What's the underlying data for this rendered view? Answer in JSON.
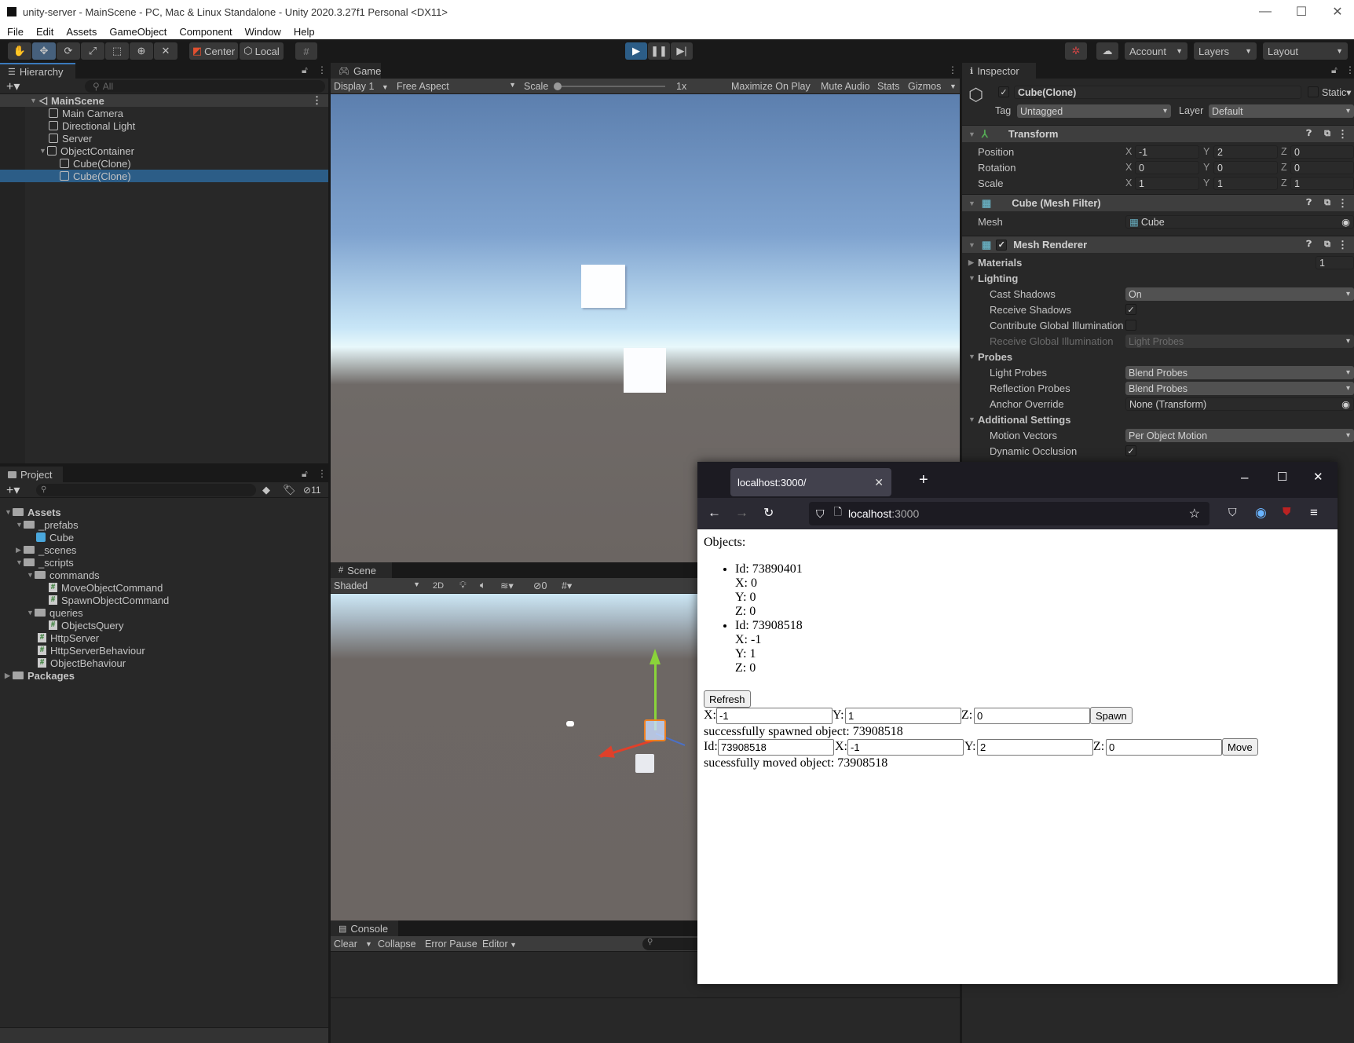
{
  "window": {
    "title": "unity-server - MainScene - PC, Mac & Linux Standalone - Unity 2020.3.27f1 Personal <DX11>",
    "controls": {
      "minimize": "—",
      "maximize": "☐",
      "close": "✕"
    }
  },
  "menu": [
    "File",
    "Edit",
    "Assets",
    "GameObject",
    "Component",
    "Window",
    "Help"
  ],
  "toolbar": {
    "tools": [
      "hand-tool",
      "move-tool",
      "rotate-tool",
      "scale-tool",
      "rect-tool",
      "transform-tool",
      "custom-tool"
    ],
    "pivot_label": "Center",
    "space_label": "Local",
    "account_label": "Account",
    "layers_label": "Layers",
    "layout_label": "Layout"
  },
  "hierarchy": {
    "tab": "Hierarchy",
    "search_placeholder": "All",
    "scene": "MainScene",
    "items": [
      {
        "label": "Main Camera",
        "depth": 1
      },
      {
        "label": "Directional Light",
        "depth": 1
      },
      {
        "label": "Server",
        "depth": 1
      },
      {
        "label": "ObjectContainer",
        "depth": 1,
        "expanded": true
      },
      {
        "label": "Cube(Clone)",
        "depth": 2
      },
      {
        "label": "Cube(Clone)",
        "depth": 2,
        "selected": true
      }
    ]
  },
  "project": {
    "tab": "Project",
    "hidden_count": "11",
    "items": [
      {
        "label": "Assets",
        "type": "folder",
        "bold": true
      },
      {
        "label": "_prefabs",
        "type": "folder"
      },
      {
        "label": "Cube",
        "type": "prefab"
      },
      {
        "label": "_scenes",
        "type": "folder"
      },
      {
        "label": "_scripts",
        "type": "folder"
      },
      {
        "label": "commands",
        "type": "folder"
      },
      {
        "label": "MoveObjectCommand",
        "type": "script"
      },
      {
        "label": "SpawnObjectCommand",
        "type": "script"
      },
      {
        "label": "queries",
        "type": "folder"
      },
      {
        "label": "ObjectsQuery",
        "type": "script"
      },
      {
        "label": "HttpServer",
        "type": "script"
      },
      {
        "label": "HttpServerBehaviour",
        "type": "script"
      },
      {
        "label": "ObjectBehaviour",
        "type": "script"
      },
      {
        "label": "Packages",
        "type": "folder",
        "bold": true
      }
    ]
  },
  "game": {
    "tab": "Game",
    "display": "Display 1",
    "aspect": "Free Aspect",
    "scale_label": "Scale",
    "scale_value": "1x",
    "maximize": "Maximize On Play",
    "mute": "Mute Audio",
    "stats": "Stats",
    "gizmos": "Gizmos"
  },
  "scene": {
    "tab": "Scene",
    "shading": "Shaded",
    "mode_2d": "2D",
    "hidden_count": "0"
  },
  "console": {
    "tab": "Console",
    "clear": "Clear",
    "collapse": "Collapse",
    "error_pause": "Error Pause",
    "editor": "Editor"
  },
  "inspector": {
    "tab": "Inspector",
    "object_name": "Cube(Clone)",
    "static_label": "Static",
    "tag_label": "Tag",
    "tag_value": "Untagged",
    "layer_label": "Layer",
    "layer_value": "Default",
    "transform": {
      "title": "Transform",
      "rows": [
        {
          "label": "Position",
          "x": "-1",
          "y": "2",
          "z": "0"
        },
        {
          "label": "Rotation",
          "x": "0",
          "y": "0",
          "z": "0"
        },
        {
          "label": "Scale",
          "x": "1",
          "y": "1",
          "z": "1"
        }
      ]
    },
    "mesh_filter": {
      "title": "Cube (Mesh Filter)",
      "mesh_label": "Mesh",
      "mesh_value": "Cube"
    },
    "mesh_renderer": {
      "title": "Mesh Renderer",
      "materials_label": "Materials",
      "materials_count": "1",
      "lighting": "Lighting",
      "cast_shadows_label": "Cast Shadows",
      "cast_shadows_value": "On",
      "receive_shadows_label": "Receive Shadows",
      "contribute_gi_label": "Contribute Global Illumination",
      "receive_gi_label": "Receive Global Illumination",
      "receive_gi_value": "Light Probes",
      "probes": "Probes",
      "light_probes_label": "Light Probes",
      "light_probes_value": "Blend Probes",
      "reflection_probes_label": "Reflection Probes",
      "reflection_probes_value": "Blend Probes",
      "anchor_label": "Anchor Override",
      "anchor_value": "None (Transform)",
      "additional": "Additional Settings",
      "motion_vectors_label": "Motion Vectors",
      "motion_vectors_value": "Per Object Motion",
      "dynamic_occlusion_label": "Dynamic Occlusion"
    }
  },
  "browser": {
    "tab_title": "localhost:3000/",
    "url_host": "localhost",
    "url_port": ":3000",
    "page": {
      "heading": "Objects:",
      "objects": [
        {
          "id": "Id: 73890401",
          "x": "X: 0",
          "y": "Y: 0",
          "z": "Z: 0"
        },
        {
          "id": "Id: 73908518",
          "x": "X: -1",
          "y": "Y: 1",
          "z": "Z: 0"
        }
      ],
      "refresh": "Refresh",
      "spawn_form": {
        "x_label": "X:",
        "x": "-1",
        "y_label": "Y:",
        "y": "1",
        "z_label": "Z:",
        "z": "0",
        "button": "Spawn"
      },
      "spawn_status": "successfully spawned object: 73908518",
      "move_form": {
        "id_label": "Id:",
        "id": "73908518",
        "x_label": "X:",
        "x": "-1",
        "y_label": "Y:",
        "y": "2",
        "z_label": "Z:",
        "z": "0",
        "button": "Move"
      },
      "move_status": "sucessfully moved object: 73908518"
    }
  },
  "colors": {
    "accent": "#2c5d87",
    "panel": "#282828",
    "tab_strip": "#191919"
  }
}
